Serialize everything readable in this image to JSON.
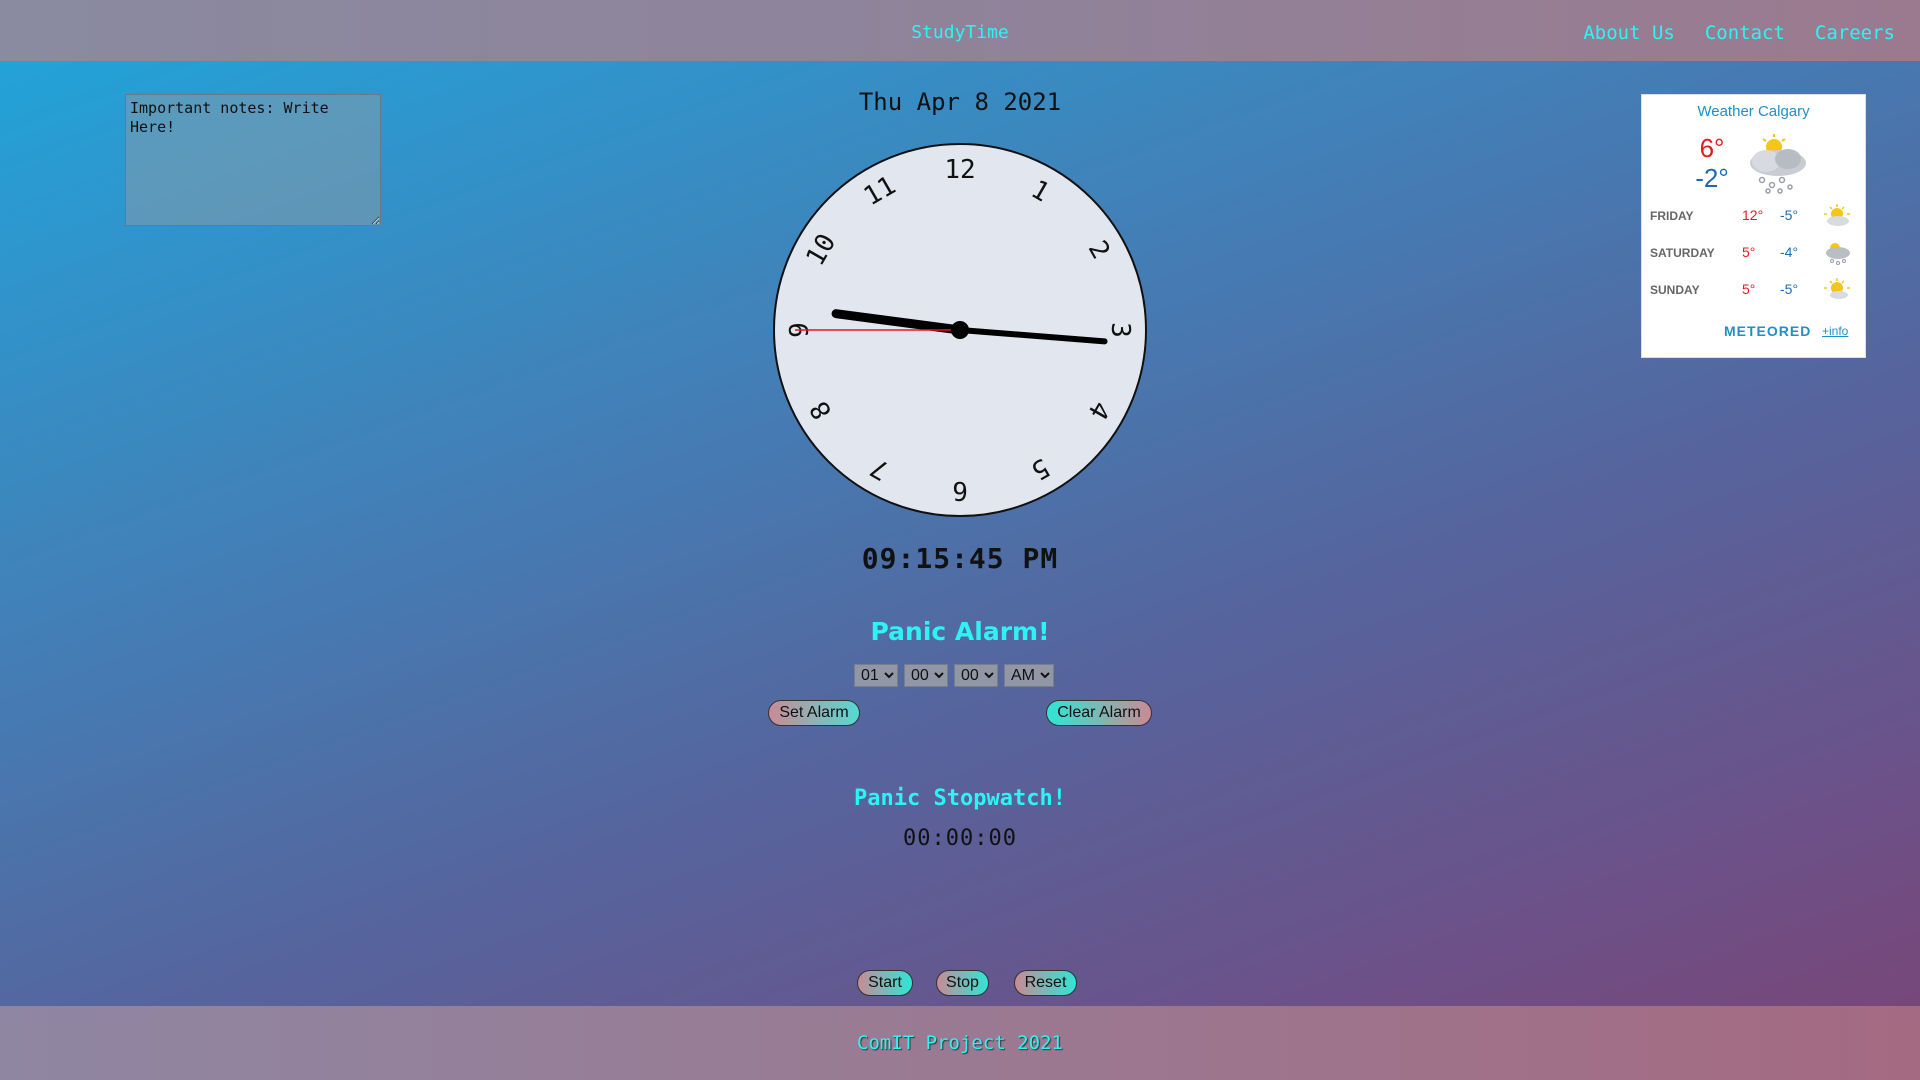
{
  "header": {
    "brand": "StudyTime",
    "nav": [
      "About Us",
      "Contact",
      "Careers"
    ]
  },
  "notes": {
    "value": "Important notes: Write Here!"
  },
  "clock": {
    "date": "Thu Apr 8 2021",
    "numbers": [
      "12",
      "1",
      "2",
      "3",
      "4",
      "5",
      "6",
      "7",
      "8",
      "9",
      "10",
      "11"
    ],
    "time": {
      "hours": 21,
      "minutes": 15,
      "seconds": 45
    },
    "digital": "09:15:45 PM",
    "second_hand_color": "#e21b1b"
  },
  "alarm": {
    "title": "Panic Alarm!",
    "hour": "01",
    "minute": "00",
    "second": "00",
    "ampm": "AM",
    "set_label": "Set Alarm",
    "clear_label": "Clear Alarm"
  },
  "stopwatch": {
    "title": "Panic Stopwatch!",
    "time": "00:00:00",
    "start_label": "Start",
    "stop_label": "Stop",
    "reset_label": "Reset"
  },
  "weather": {
    "title": "Weather Calgary",
    "today_hi": "6°",
    "today_lo": "-2°",
    "today_icon": "snow-cloud-icon",
    "forecast": [
      {
        "day": "FRIDAY",
        "hi": "12°",
        "lo": "-5°",
        "icon": "sun-cloud-icon"
      },
      {
        "day": "SATURDAY",
        "hi": "5°",
        "lo": "-4°",
        "icon": "snow-cloud-icon"
      },
      {
        "day": "SUNDAY",
        "hi": "5°",
        "lo": "-5°",
        "icon": "sun-cloud-icon"
      }
    ],
    "brand": "METEORED",
    "info": "+info"
  },
  "footer": {
    "text": "ComIT Project 2021"
  }
}
